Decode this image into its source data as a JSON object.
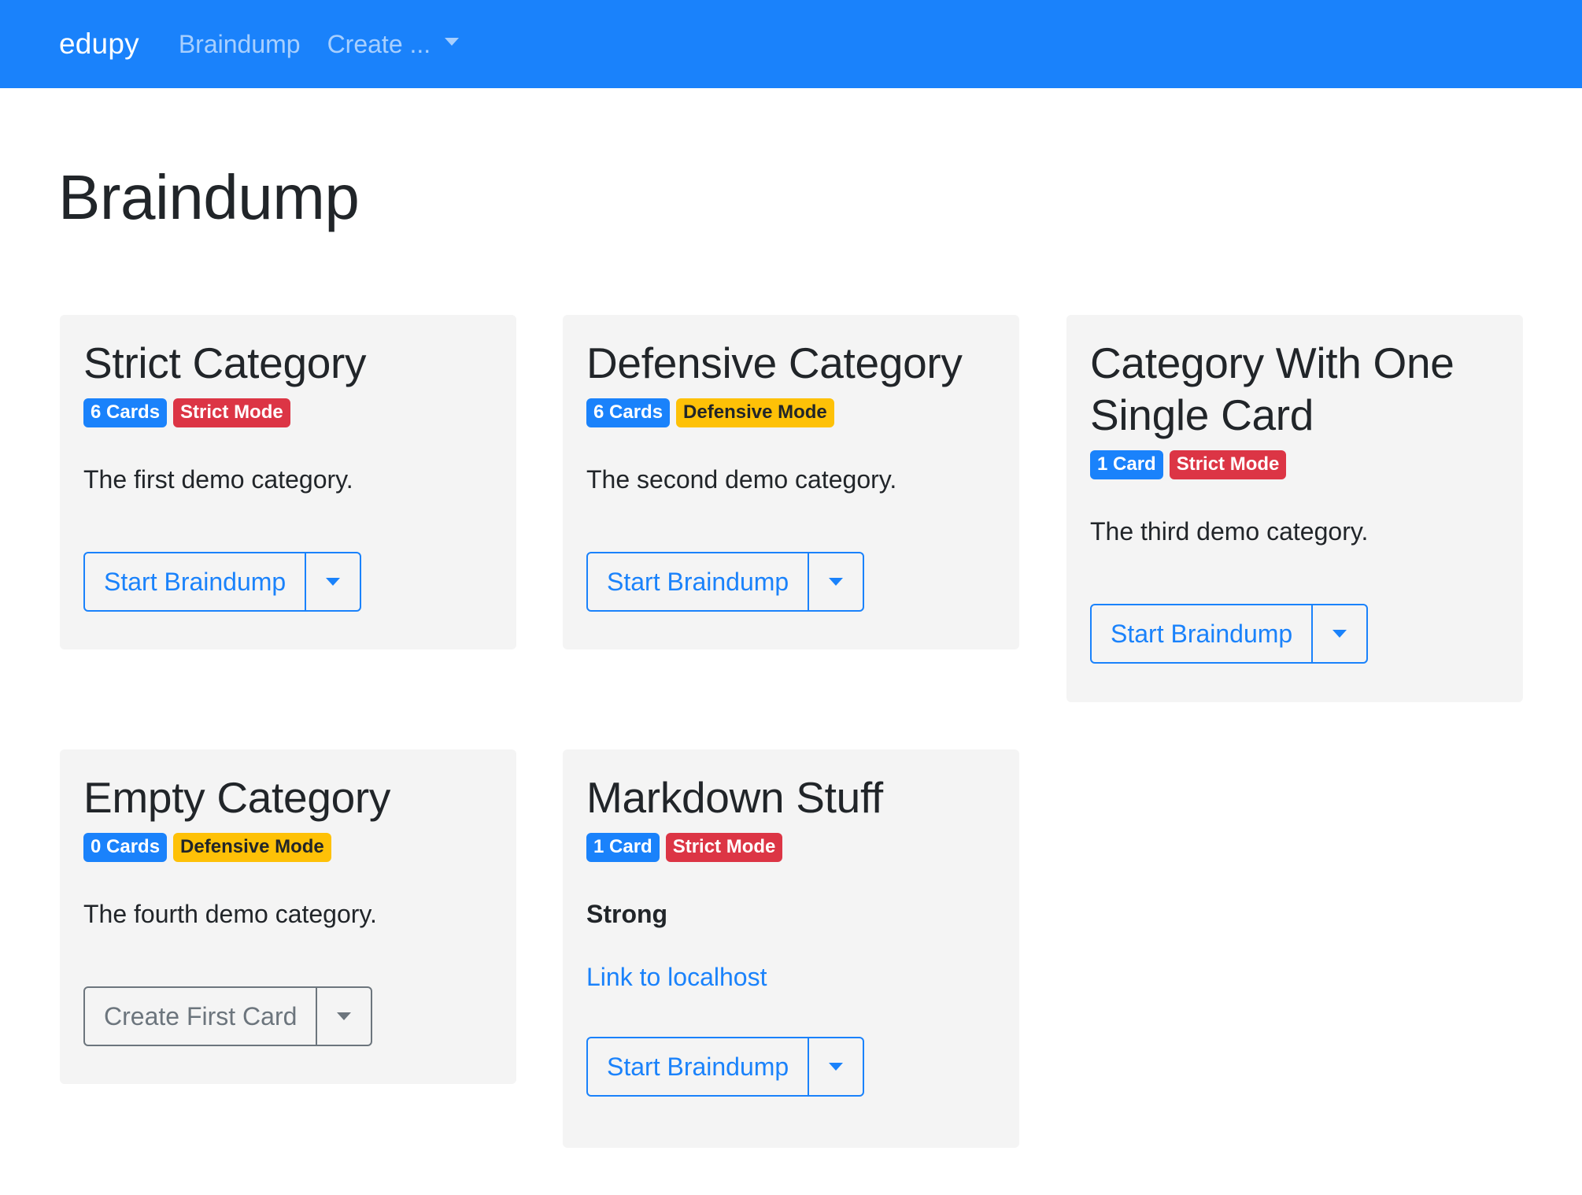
{
  "navbar": {
    "brand": "edupy",
    "links": [
      {
        "label": "Braindump"
      },
      {
        "label": "Create ..."
      }
    ]
  },
  "page": {
    "title": "Braindump"
  },
  "categories": [
    {
      "title": "Strict Category",
      "count_badge": "6 Cards",
      "mode_badge": "Strict Mode",
      "description": "The first demo category.",
      "button_label": "Start Braindump"
    },
    {
      "title": "Defensive Category",
      "count_badge": "6 Cards",
      "mode_badge": "Defensive Mode",
      "description": "The second demo category.",
      "button_label": "Start Braindump"
    },
    {
      "title": "Category With One Single Card",
      "count_badge": "1 Card",
      "mode_badge": "Strict Mode",
      "description": "The third demo category.",
      "button_label": "Start Braindump"
    },
    {
      "title": "Empty Category",
      "count_badge": "0 Cards",
      "mode_badge": "Defensive Mode",
      "description": "The fourth demo category.",
      "button_label": "Create First Card"
    },
    {
      "title": "Markdown Stuff",
      "count_badge": "1 Card",
      "mode_badge": "Strict Mode",
      "description_strong": "Strong",
      "description_link": "Link to localhost",
      "button_label": "Start Braindump"
    }
  ],
  "colors": {
    "primary": "#1a82fb",
    "danger": "#dc3545",
    "warning": "#fec107",
    "secondary": "#6c757d",
    "card_background": "#f4f4f4"
  },
  "icons": {
    "dropdown": "caret-down-icon"
  }
}
